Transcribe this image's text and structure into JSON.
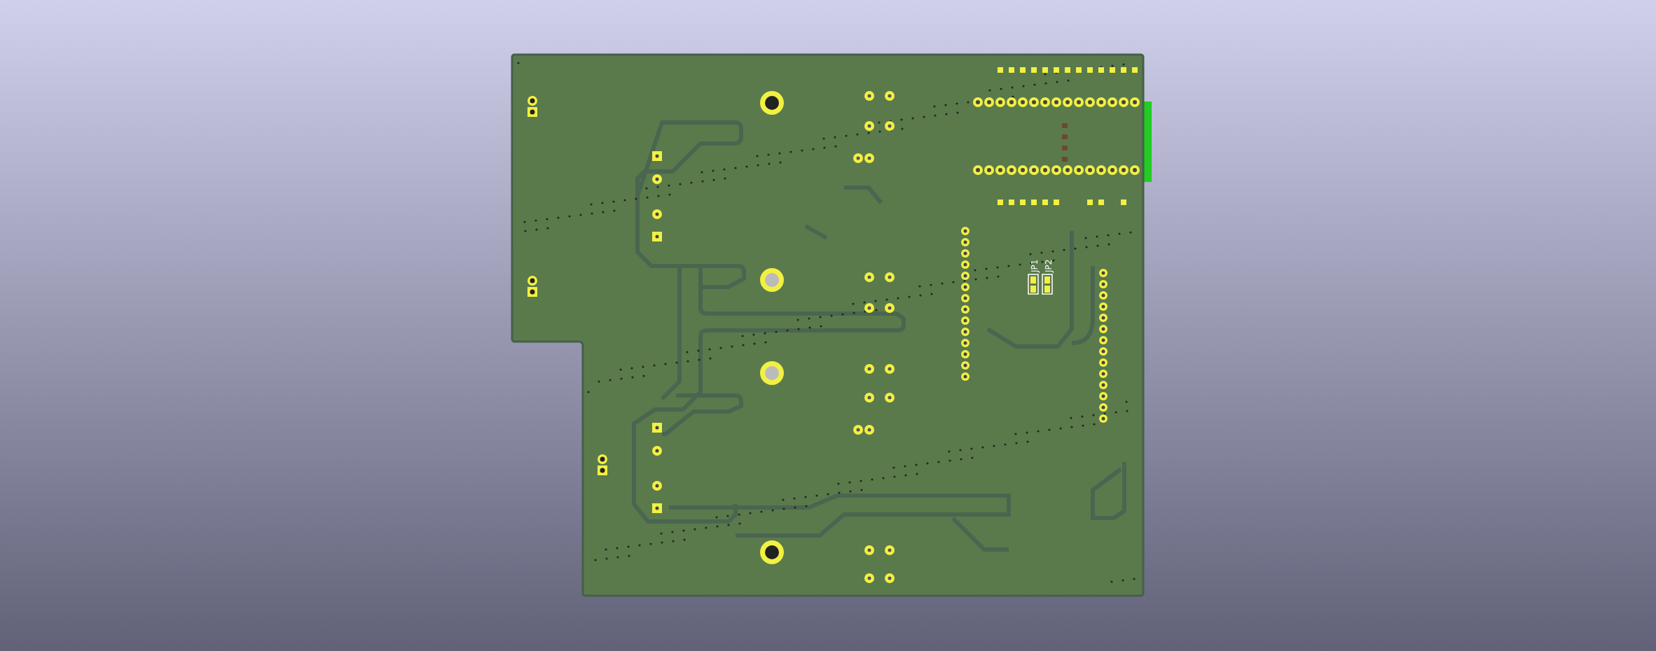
{
  "board": {
    "jumpers": [
      {
        "label": "JP1"
      },
      {
        "label": "JP2"
      }
    ]
  }
}
